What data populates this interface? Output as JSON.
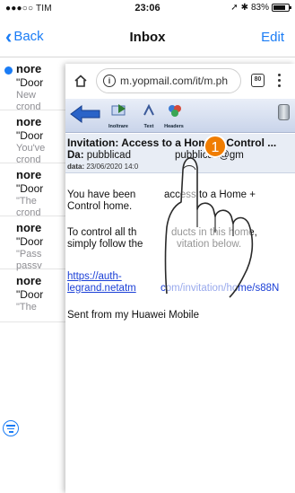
{
  "status_bar": {
    "carrier": "●●●○○ TIM",
    "time": "23:06",
    "battery_text": "83%",
    "battery_level": 0.83
  },
  "nav": {
    "back_label": "Back",
    "title": "Inbox",
    "edit_label": "Edit"
  },
  "mail_list": [
    {
      "sender": "nore",
      "subject": "\"Door",
      "preview_1": "New",
      "preview_2": "crond",
      "unread": true
    },
    {
      "sender": "nore",
      "subject": "\"Door",
      "preview_1": "You've",
      "preview_2": "crond",
      "unread": false
    },
    {
      "sender": "nore",
      "subject": "\"Door",
      "preview_1": "\"The",
      "preview_2": "crond",
      "unread": false
    },
    {
      "sender": "nore",
      "subject": "\"Door",
      "preview_1": "\"Pass",
      "preview_2": "passv",
      "unread": false
    },
    {
      "sender": "nore",
      "subject": "\"Door",
      "preview_1": "\"The",
      "preview_2": "",
      "unread": false
    }
  ],
  "browser": {
    "url": "m.yopmail.com/it/m.ph",
    "tab_count": "80",
    "toolbar": {
      "forward_label": "Inoltrare",
      "text_label": "Text",
      "headers_label": "Headers"
    },
    "message": {
      "subject": "Invitation: Access to a Home + Control ...",
      "from_label": "Da:",
      "from_value": "pubblicad",
      "from_value_2": "pubblicad@gm",
      "date_label": "data:",
      "date_value": "23/06/2020 14:0",
      "body_1a": "You have been",
      "body_1b": "access to a Home +",
      "body_1c": "Control home.",
      "body_2a": "To control all th",
      "body_2b": "ducts in this home,",
      "body_2c": "simply follow the",
      "body_2d": "vitation below.",
      "link_1": "https://auth-",
      "link_2": "legrand.netatm",
      "link_3": "com/invitation/home/s88N",
      "signature": "Sent from my Huawei Mobile"
    }
  },
  "step_marker": "1",
  "colors": {
    "ios_blue": "#1a7cf5",
    "step_orange": "#f07d00",
    "link_blue": "#1a3fd6"
  }
}
